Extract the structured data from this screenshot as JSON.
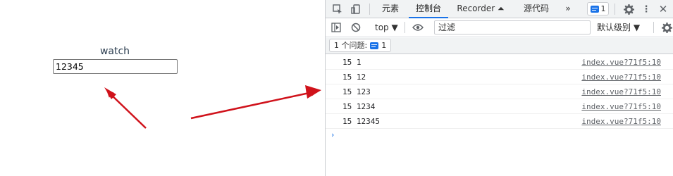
{
  "app": {
    "title": "watch",
    "input_value": "12345"
  },
  "devtools": {
    "tabs": [
      {
        "label": "元素",
        "active": false
      },
      {
        "label": "控制台",
        "active": true
      },
      {
        "label": "Recorder ⏶",
        "active": false
      },
      {
        "label": "源代码",
        "active": false
      }
    ],
    "more_tabs": "»",
    "issue_count": "1",
    "context": "top ▼",
    "filter_placeholder": "过滤",
    "levels": "默认级别 ▼",
    "issues_label": "1 个问题:",
    "issues_count": "1",
    "logs": [
      {
        "message": "15 1",
        "source": "index.vue?71f5:10"
      },
      {
        "message": "15 12",
        "source": "index.vue?71f5:10"
      },
      {
        "message": "15 123",
        "source": "index.vue?71f5:10"
      },
      {
        "message": "15 1234",
        "source": "index.vue?71f5:10"
      },
      {
        "message": "15 12345",
        "source": "index.vue?71f5:10"
      }
    ],
    "prompt": "›"
  },
  "colors": {
    "annotation_arrow": "#d0121b",
    "accent": "#1a73e8"
  }
}
